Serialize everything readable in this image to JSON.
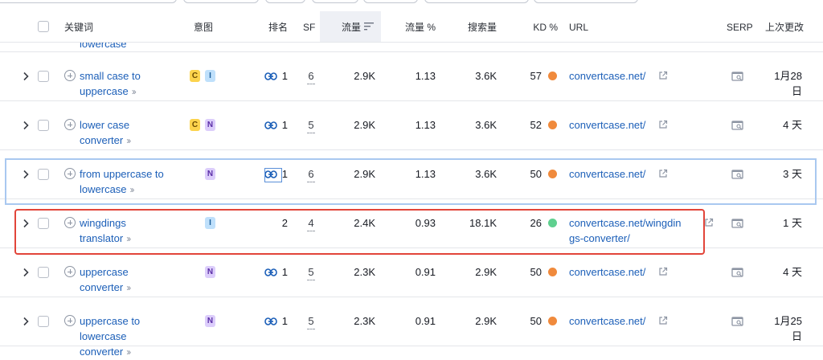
{
  "table": {
    "headers": {
      "keyword": "关键词",
      "intent": "意图",
      "rank": "排名",
      "sf": "SF",
      "traffic": "流量",
      "traffic_pct": "流量 %",
      "volume": "搜索量",
      "kd": "KD %",
      "url": "URL",
      "serp": "SERP",
      "updated": "上次更改"
    },
    "partial_row_keyword": "lowercase",
    "rows": [
      {
        "kw1": "small case to",
        "kw2": "uppercase",
        "intents": [
          "C",
          "I"
        ],
        "rank": "1",
        "has_link": true,
        "sf": "6",
        "traffic": "2.9K",
        "traffic_pct": "1.13",
        "volume": "3.6K",
        "kd": "57",
        "kd_color": "#f08a3c",
        "url1": "convertcase.net/",
        "url2": "",
        "upd1": "1月28",
        "upd2": "日"
      },
      {
        "kw1": "lower case",
        "kw2": "converter",
        "intents": [
          "C",
          "N"
        ],
        "rank": "1",
        "has_link": true,
        "sf": "5",
        "traffic": "2.9K",
        "traffic_pct": "1.13",
        "volume": "3.6K",
        "kd": "52",
        "kd_color": "#f08a3c",
        "url1": "convertcase.net/",
        "url2": "",
        "upd1": "4 天",
        "upd2": ""
      },
      {
        "kw1": "from uppercase to",
        "kw2": "lowercase",
        "intents": [
          "N"
        ],
        "rank": "1",
        "has_link": true,
        "sf": "6",
        "traffic": "2.9K",
        "traffic_pct": "1.13",
        "volume": "3.6K",
        "kd": "50",
        "kd_color": "#f08a3c",
        "url1": "convertcase.net/",
        "url2": "",
        "upd1": "3 天",
        "upd2": ""
      },
      {
        "kw1": "wingdings",
        "kw2": "translator",
        "intents": [
          "I"
        ],
        "rank": "2",
        "has_link": false,
        "sf": "4",
        "traffic": "2.4K",
        "traffic_pct": "0.93",
        "volume": "18.1K",
        "kd": "26",
        "kd_color": "#5fd08f",
        "url1": "convertcase.net/wingdin",
        "url2": "gs-converter/",
        "upd1": "1 天",
        "upd2": ""
      },
      {
        "kw1": "uppercase",
        "kw2": "converter",
        "intents": [
          "N"
        ],
        "rank": "1",
        "has_link": true,
        "sf": "5",
        "traffic": "2.3K",
        "traffic_pct": "0.91",
        "volume": "2.9K",
        "kd": "50",
        "kd_color": "#f08a3c",
        "url1": "convertcase.net/",
        "url2": "",
        "upd1": "4 天",
        "upd2": ""
      },
      {
        "kw1": "uppercase to",
        "kw2": "lowercase",
        "kw3": "converter",
        "intents": [
          "N"
        ],
        "rank": "1",
        "has_link": true,
        "sf": "5",
        "traffic": "2.3K",
        "traffic_pct": "0.91",
        "volume": "2.9K",
        "kd": "50",
        "kd_color": "#f08a3c",
        "url1": "convertcase.net/",
        "url2": "",
        "upd1": "1月25",
        "upd2": "日"
      }
    ]
  },
  "icons": {
    "expand": "chevron-right-icon",
    "add": "plus-circle-icon",
    "rank_link": "link-icon",
    "external": "external-link-icon",
    "serp": "serp-snapshot-icon",
    "sort": "sort-descending-icon"
  }
}
